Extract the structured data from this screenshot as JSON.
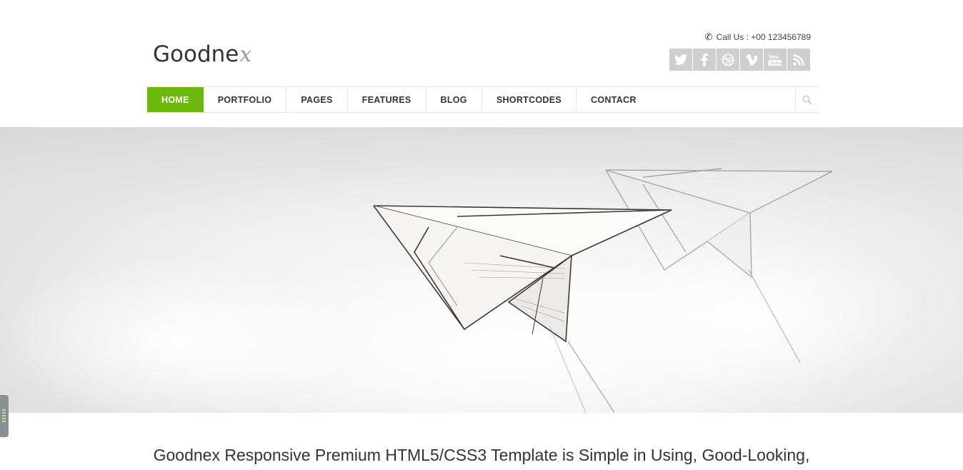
{
  "header": {
    "logo_text": "Goodne",
    "logo_tail": "x",
    "call_us": "Call Us : +00 123456789",
    "social": [
      {
        "name": "twitter-icon"
      },
      {
        "name": "facebook-icon"
      },
      {
        "name": "dribbble-icon"
      },
      {
        "name": "vimeo-icon"
      },
      {
        "name": "youtube-icon"
      },
      {
        "name": "rss-icon"
      }
    ]
  },
  "nav": {
    "items": [
      {
        "label": "HOME",
        "active": true
      },
      {
        "label": "PORTFOLIO"
      },
      {
        "label": "PAGES"
      },
      {
        "label": "FEATURES"
      },
      {
        "label": "BLOG"
      },
      {
        "label": "SHORTCODES"
      },
      {
        "label": "CONTACR"
      }
    ]
  },
  "colors": {
    "accent": "#6cb80e",
    "social_bg": "#cfcfcf"
  },
  "content": {
    "tagline": "Goodnex Responsive Premium HTML5/CSS3 Template is Simple in Using, Good-Looking,"
  }
}
